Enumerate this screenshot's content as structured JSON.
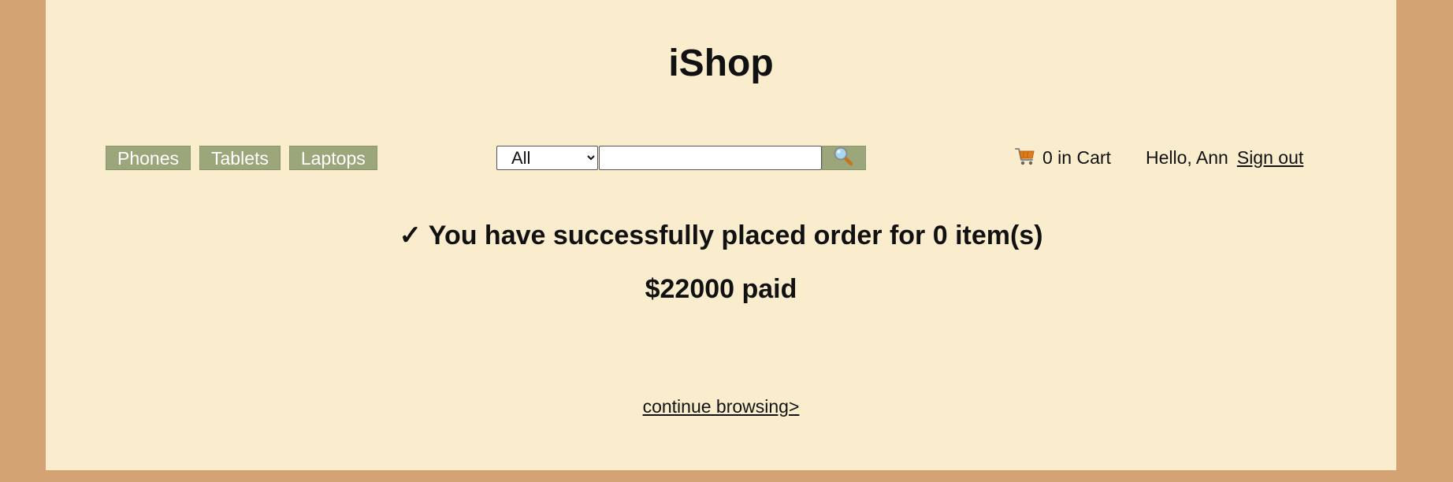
{
  "header": {
    "title": "iShop"
  },
  "nav": {
    "items": [
      {
        "label": "Phones"
      },
      {
        "label": "Tablets"
      },
      {
        "label": "Laptops"
      }
    ]
  },
  "search": {
    "category_selected": "All",
    "category_options": [
      "All"
    ],
    "query": "",
    "button_icon": "magnifier-icon"
  },
  "cart": {
    "icon": "cart-icon",
    "label": "0 in Cart"
  },
  "user": {
    "greeting": "Hello, Ann",
    "signout_label": "Sign out"
  },
  "confirmation": {
    "message": "✓ You have successfully placed order for 0 item(s)",
    "paid": "$22000 paid"
  },
  "footer": {
    "continue_label": "continue browsing>"
  },
  "colors": {
    "outer_background": "#d4a373",
    "page_background": "#faedcd",
    "nav_button": "#9ba77b",
    "cart_icon": "#e07b1a"
  }
}
